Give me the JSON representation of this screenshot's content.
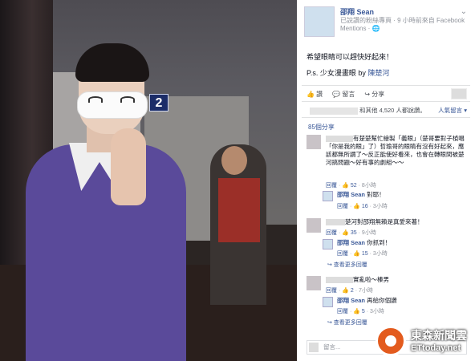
{
  "header": {
    "name": "邵翔 Sean",
    "subtitle": "已說讚的粉絲專頁 · 9 小時前來自 Facebook Mentions · 🌐",
    "menu": "⌄"
  },
  "post": {
    "text": "希望眼睛可以趕快好起來！",
    "ps_prefix": "P.s. 少女漫畫眼 by ",
    "ps_link": "陳楚河"
  },
  "actions": {
    "like": "👍 讚",
    "comment": "💬 留言",
    "share": "↪ 分享"
  },
  "stats": {
    "views": "和其他 4,520 人都說讚。",
    "sort": "人氣留言 ▾",
    "shares": "85個分享"
  },
  "comments": [
    {
      "text": "有楚楚幫忙繪製「義眼」（楚哥要對子楨唱「你是我的眼」了）哲瑜哥的眼睛有沒有好起來，應該都無所謂了～反正能使好看來，也會在轉眼間被楚河搞問題～好有事的劇組～～",
      "meta_reply": "回覆",
      "meta_likes": "👍 52",
      "meta_time": "8小時"
    },
    {
      "author": "邵翔 Sean",
      "text": " 對耶！",
      "meta_reply": "回覆",
      "meta_likes": "👍 16",
      "meta_time": "3小時"
    },
    {
      "text": "楚河對邵翔無賴是真愛來著！",
      "meta_reply": "回覆",
      "meta_likes": "👍 35",
      "meta_time": "9小時"
    },
    {
      "author": "邵翔 Sean",
      "text": " 你抓到！",
      "meta_reply": "回覆",
      "meta_likes": "👍 15",
      "meta_time": "3小時",
      "more": "↪ 查看更多回覆"
    },
    {
      "text": "實亂啦～榛男",
      "meta_reply": "回覆",
      "meta_likes": "👍 2",
      "meta_time": "7小時"
    },
    {
      "author": "邵翔 Sean",
      "text": " 再給你個讚",
      "meta_reply": "回覆",
      "meta_likes": "👍 5",
      "meta_time": "3小時",
      "more": "↪ 查看更多回覆"
    }
  ],
  "input": {
    "placeholder": "留言..."
  },
  "photo": {
    "sign": "2"
  },
  "watermark": {
    "zh": "東森新聞雲",
    "en": "ETtoday.net"
  },
  "colors": {
    "fb_blue": "#3b5998",
    "gray": "#90949c",
    "cardigan": "#5a4a9a",
    "wm_orange": "#e35b1e"
  }
}
